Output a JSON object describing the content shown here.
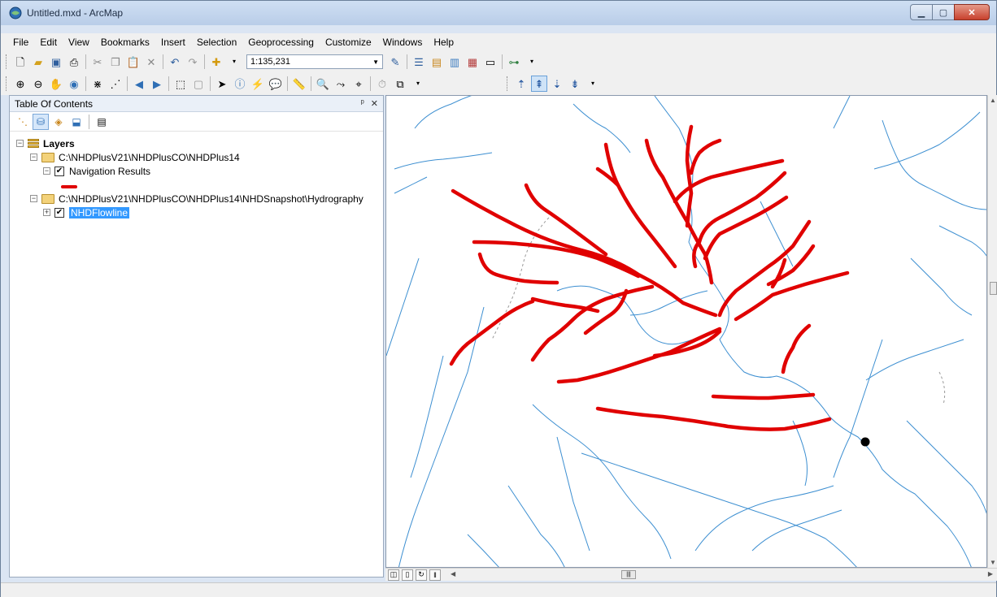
{
  "window": {
    "title": "Untitled.mxd - ArcMap",
    "buttons": {
      "minimize": "▁",
      "maximize": "▢",
      "close": "✕"
    }
  },
  "menu": [
    "File",
    "Edit",
    "View",
    "Bookmarks",
    "Insert",
    "Selection",
    "Geoprocessing",
    "Customize",
    "Windows",
    "Help"
  ],
  "toolbar": {
    "scale_value": "1:135,231"
  },
  "toc": {
    "title": "Table Of Contents",
    "pin": "ᵖ",
    "close": "✕",
    "layers_label": "Layers",
    "group1_path": "C:\\NHDPlusV21\\NHDPlusCO\\NHDPlus14",
    "layer1_label": "Navigation Results",
    "group2_path": "C:\\NHDPlusV21\\NHDPlusCO\\NHDPlus14\\NHDSnapshot\\Hydrography",
    "layer2_label": "NHDFlowline",
    "collapse_glyph": "−",
    "expand_glyph": "+",
    "check_glyph": "✔"
  },
  "colors": {
    "navigation_results": "#e00000",
    "flowline": "#3d8fd1",
    "start_point": "#000000",
    "selection": "#3399ff"
  },
  "icons": {
    "app": "arcmap-globe-icon",
    "folder": "folder-icon",
    "layers": "layers-icon"
  }
}
